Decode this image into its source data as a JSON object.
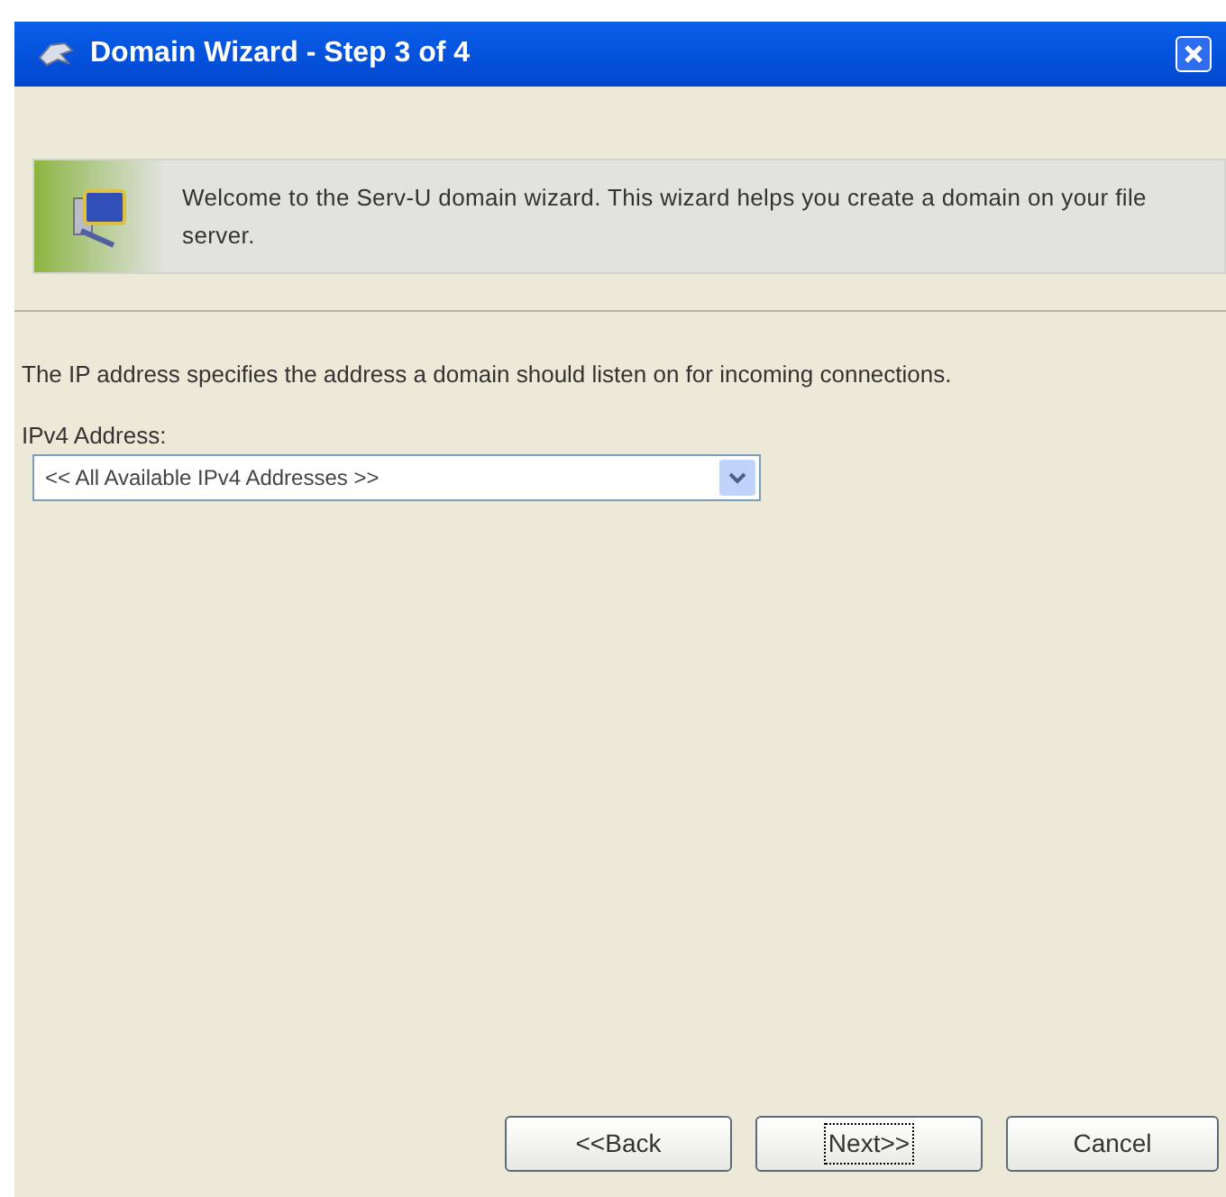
{
  "window": {
    "title": "Domain Wizard - Step 3 of 4"
  },
  "banner": {
    "text": "Welcome to the Serv-U domain wizard. This wizard helps you create a domain on your file server."
  },
  "description": "The IP address specifies the address a domain should listen on for incoming connections.",
  "ipv4_field": {
    "label": "IPv4 Address:",
    "value": "<< All Available IPv4 Addresses >>"
  },
  "buttons": [
    {
      "label": "<<Back",
      "focused": false
    },
    {
      "label": "Next>>",
      "focused": true
    },
    {
      "label": "Cancel",
      "focused": false
    }
  ]
}
